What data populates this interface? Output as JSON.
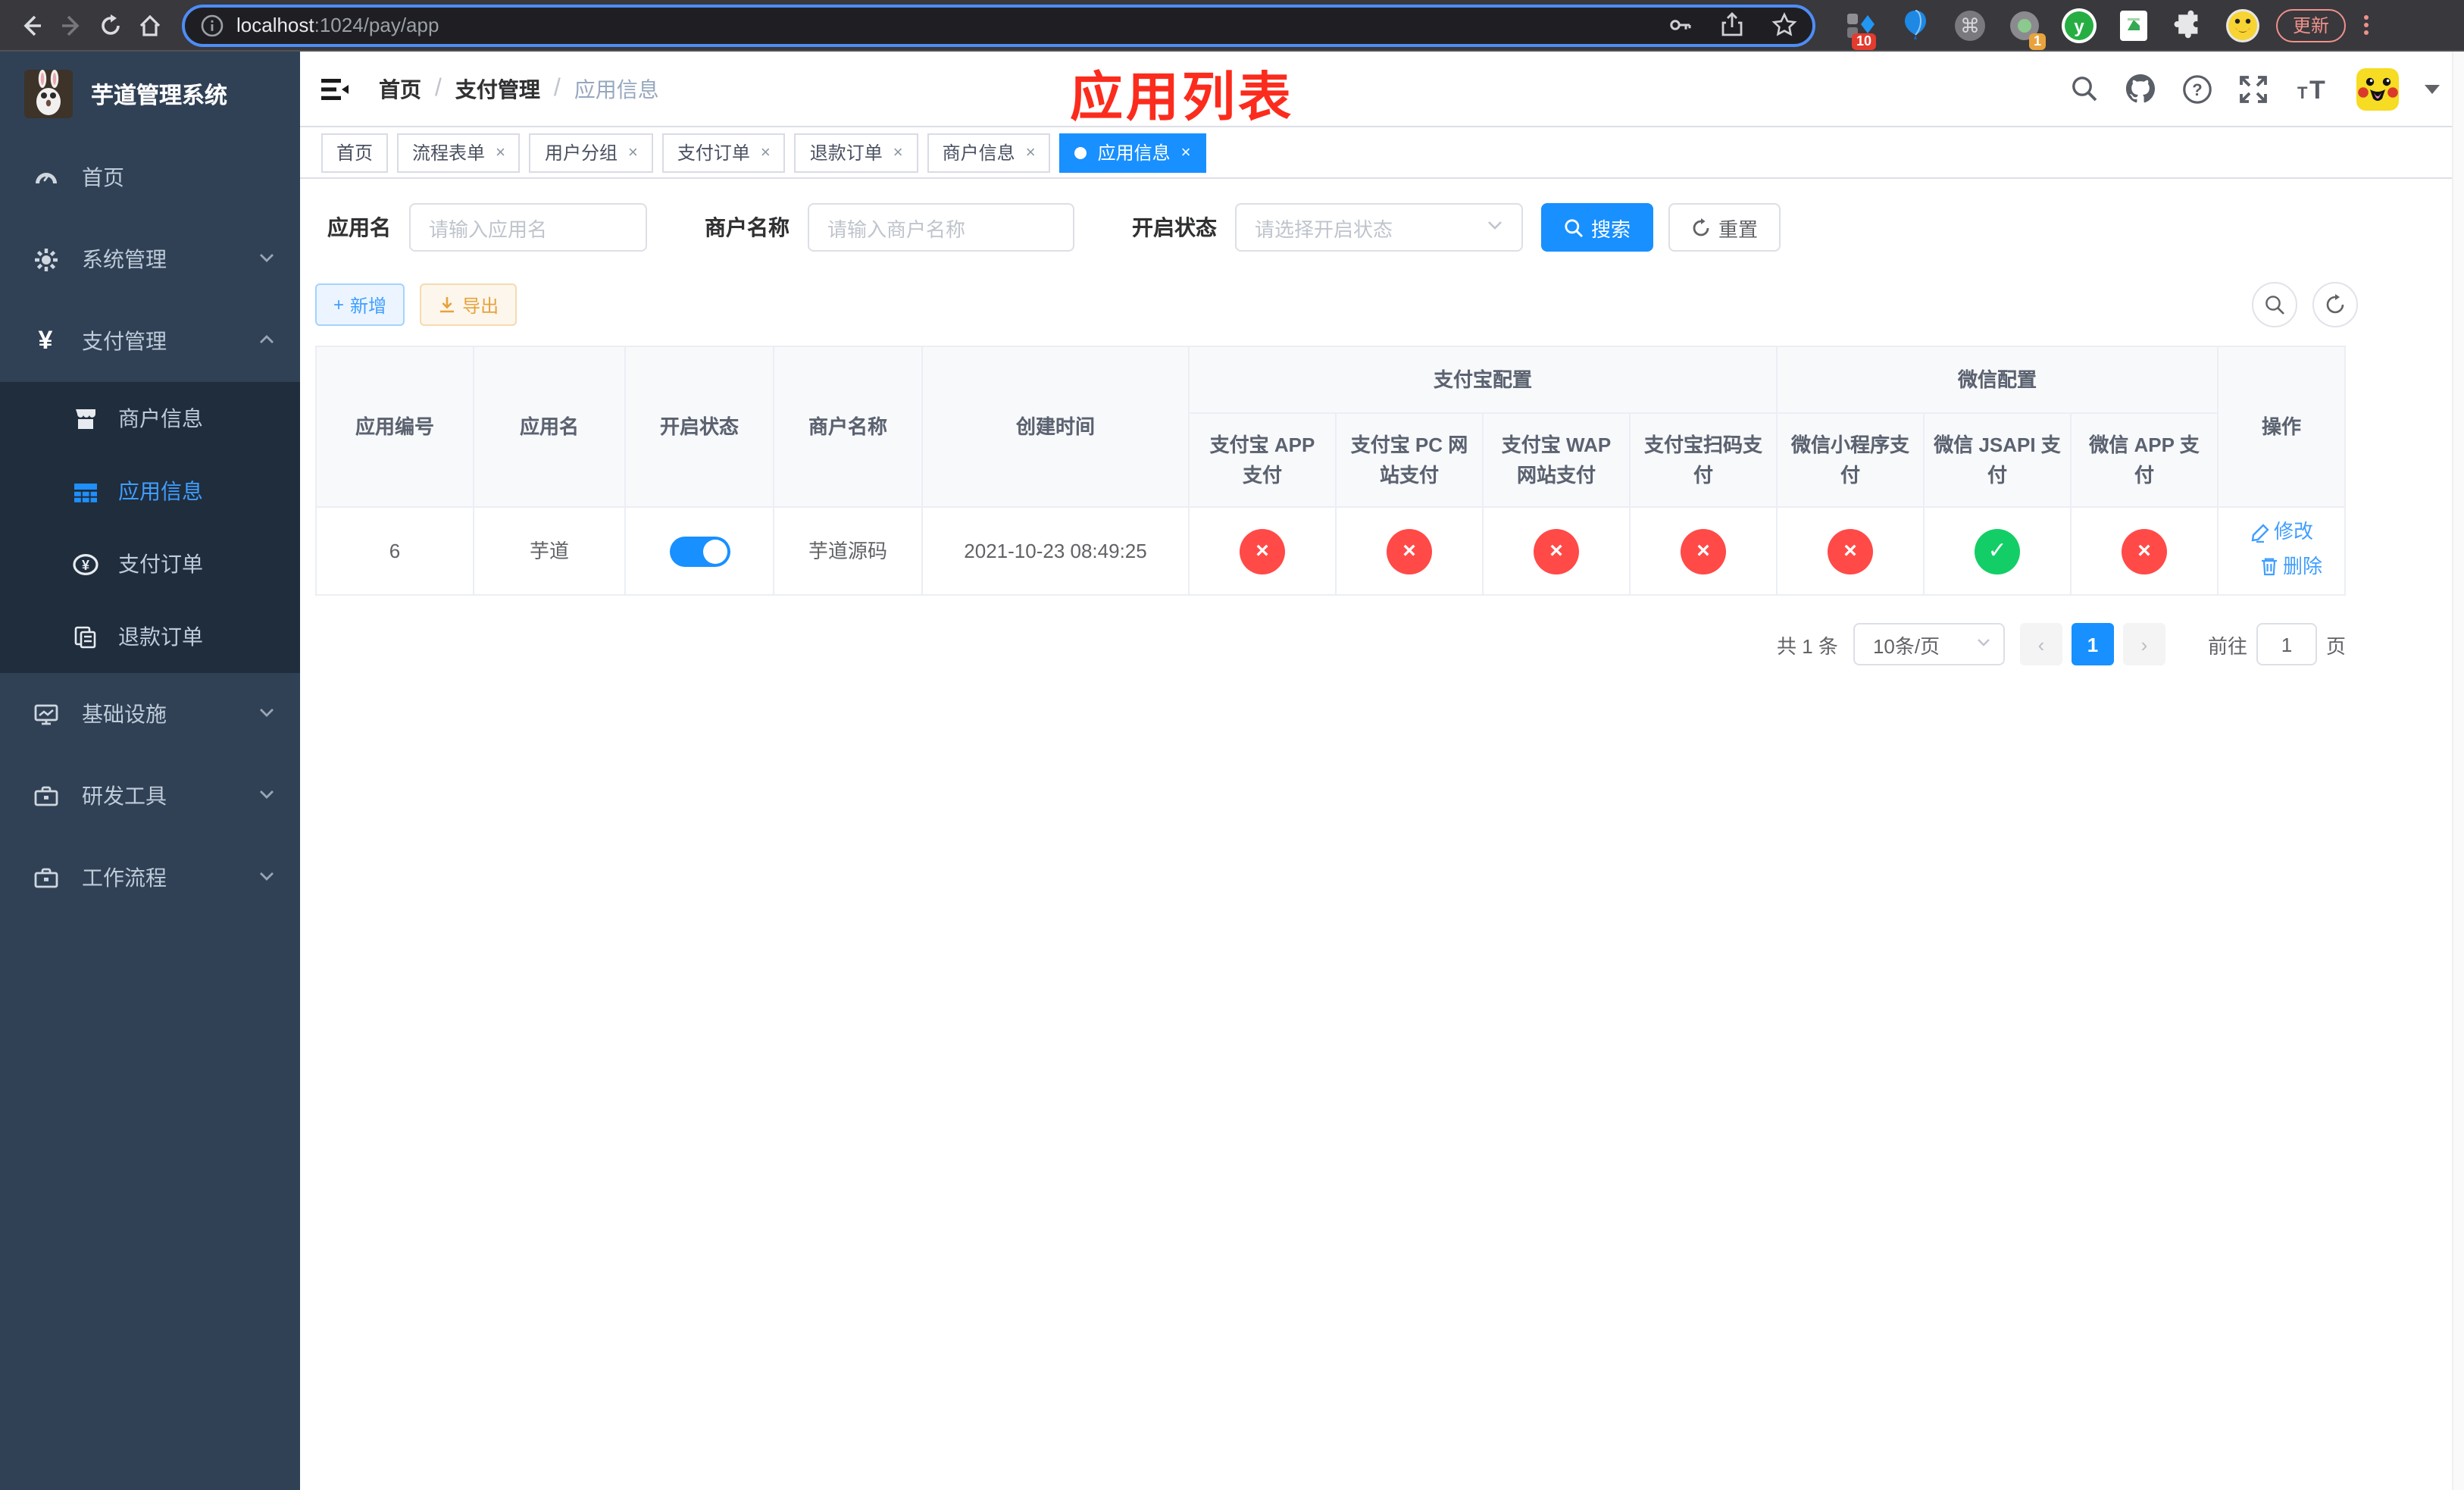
{
  "browser": {
    "url_host": "localhost",
    "url_path": ":1024/pay/app",
    "update_label": "更新",
    "ext_badge_blocks": "10",
    "ext_badge_record": "1"
  },
  "annotation": {
    "page_title": "应用列表",
    "color": "#fb2c1d"
  },
  "sidebar": {
    "title": "芋道管理系统",
    "items": [
      {
        "label": "首页"
      },
      {
        "label": "系统管理"
      },
      {
        "label": "支付管理"
      },
      {
        "label": "商户信息"
      },
      {
        "label": "应用信息"
      },
      {
        "label": "支付订单"
      },
      {
        "label": "退款订单"
      },
      {
        "label": "基础设施"
      },
      {
        "label": "研发工具"
      },
      {
        "label": "工作流程"
      }
    ]
  },
  "breadcrumb": {
    "items": [
      "首页",
      "支付管理",
      "应用信息"
    ]
  },
  "tabs": [
    {
      "label": "首页"
    },
    {
      "label": "流程表单"
    },
    {
      "label": "用户分组"
    },
    {
      "label": "支付订单"
    },
    {
      "label": "退款订单"
    },
    {
      "label": "商户信息"
    },
    {
      "label": "应用信息"
    }
  ],
  "search_form": {
    "app_name_label": "应用名",
    "app_name_placeholder": "请输入应用名",
    "merchant_label": "商户名称",
    "merchant_placeholder": "请输入商户名称",
    "status_label": "开启状态",
    "status_placeholder": "请选择开启状态",
    "search_label": "搜索",
    "reset_label": "重置"
  },
  "actions": {
    "add_label": "新增",
    "export_label": "导出"
  },
  "table": {
    "columns": {
      "app_id": "应用编号",
      "app_name": "应用名",
      "status": "开启状态",
      "merchant": "商户名称",
      "create_time": "创建时间",
      "alipay_group": "支付宝配置",
      "wechat_group": "微信配置",
      "op": "操作"
    },
    "sub_columns": [
      "支付宝 APP 支付",
      "支付宝 PC 网站支付",
      "支付宝 WAP 网站支付",
      "支付宝扫码支付",
      "微信小程序支付",
      "微信 JSAPI 支付",
      "微信 APP 支付"
    ],
    "row": {
      "app_id": "6",
      "app_name": "芋道",
      "enabled": true,
      "merchant_name": "芋道源码",
      "create_time": "2021-10-23 08:49:25",
      "statuses": [
        false,
        false,
        false,
        false,
        false,
        true,
        false
      ],
      "edit_label": "修改",
      "delete_label": "删除"
    }
  },
  "pagination": {
    "total_label": "共 1 条",
    "page_size": "10条/页",
    "current_page": "1",
    "goto_label": "前往",
    "goto_value": "1",
    "page_suffix": "页"
  },
  "colors": {
    "accent_blue": "#1890ff",
    "link_blue": "#409eff",
    "danger_red": "#ff4a48",
    "success_green": "#13ce66",
    "sidebar_bg": "#304156",
    "submenu_bg": "#1f2d3d"
  }
}
